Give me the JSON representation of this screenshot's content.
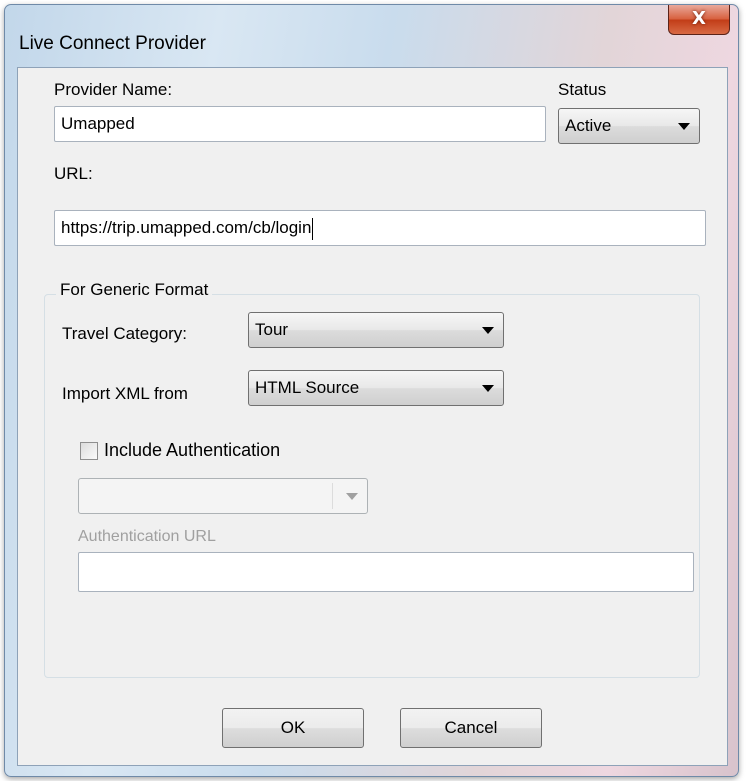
{
  "window": {
    "title": "Live Connect Provider",
    "close_symbol": "X"
  },
  "provider": {
    "label": "Provider Name:",
    "value": "Umapped"
  },
  "status": {
    "label": "Status",
    "selected": "Active"
  },
  "url": {
    "label": "URL:",
    "value": "https://trip.umapped.com/cb/login"
  },
  "generic": {
    "title": "For Generic Format",
    "travel_category_label": "Travel Category:",
    "travel_category_value": "Tour",
    "import_xml_label": "Import XML from",
    "import_xml_value": "HTML Source",
    "include_auth_label": "Include Authentication",
    "include_auth_checked": false,
    "auth_method_value": "",
    "auth_url_label": "Authentication URL",
    "auth_url_value": ""
  },
  "buttons": {
    "ok": "OK",
    "cancel": "Cancel"
  }
}
